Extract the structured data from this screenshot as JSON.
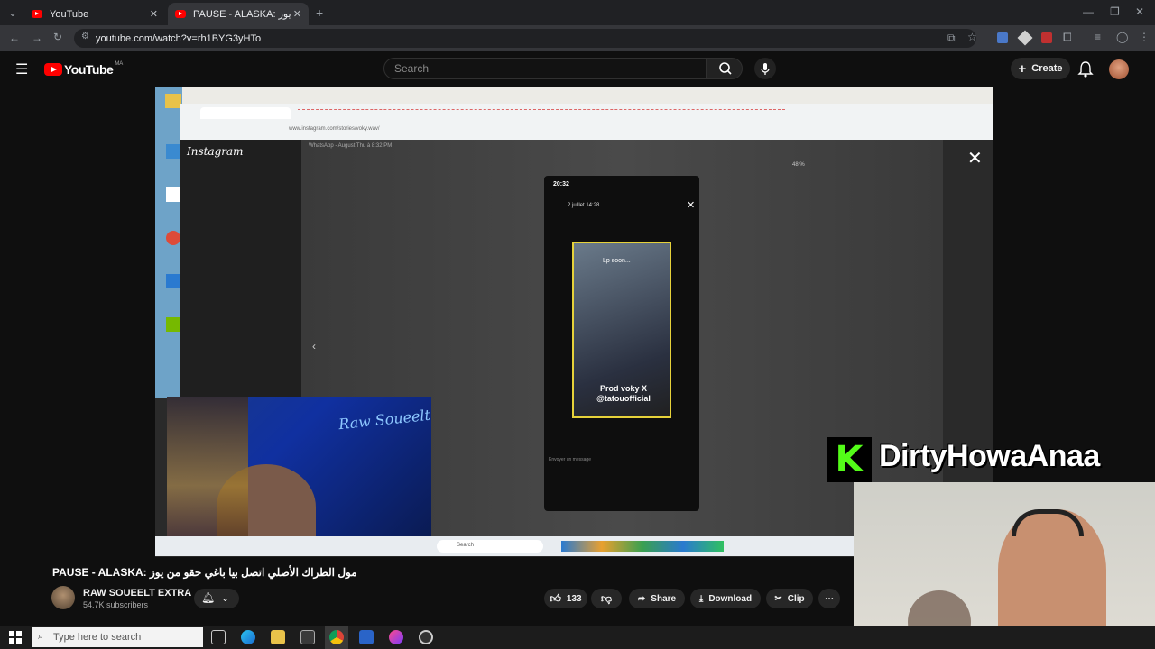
{
  "browser": {
    "tabs": [
      {
        "title": "YouTube",
        "active": false
      },
      {
        "title": "PAUSE - ALASKA: مول الطراك الأصلي اتصل بيا باغي حقو من يوز",
        "active": true
      }
    ],
    "url": "youtube.com/watch?v=rh1BYG3yHTo"
  },
  "youtube": {
    "logo_text": "YouTube",
    "country_code": "MA",
    "search_placeholder": "Search",
    "create_label": "Create"
  },
  "video": {
    "inner_app_title": "Instagram",
    "inner_url": "www.instagram.com/stories/voky.wav/",
    "phone_time": "20:32",
    "story_date": "2 juillet  14:28",
    "story_caption": "Prod voky X @tatouofficial",
    "story_top_text": "Lp soon...",
    "overlay_brand": "DirtyHowaAnaa",
    "overlay_letter": "K",
    "streamer_name_overlay": "Raw Soueelt",
    "inner_window_title": "WhatsApp - August Thu à 8:32 PM",
    "inner_search": "Search",
    "inner_zoom": "48 %",
    "story_input": "Envoyer un message"
  },
  "meta": {
    "title": "PAUSE - ALASKA: مول الطراك الأصلي اتصل بيا باغي حقو من يوز",
    "channel": "RAW SOUEELT EXTRA",
    "subscribers": "54.7K subscribers",
    "likes": "133",
    "share": "Share",
    "download": "Download",
    "clip": "Clip"
  },
  "taskbar": {
    "search_placeholder": "Type here to search"
  },
  "colors": {
    "youtube_red": "#ff0000",
    "story_border": "#e6d23a",
    "kick_green": "#53fc18"
  }
}
